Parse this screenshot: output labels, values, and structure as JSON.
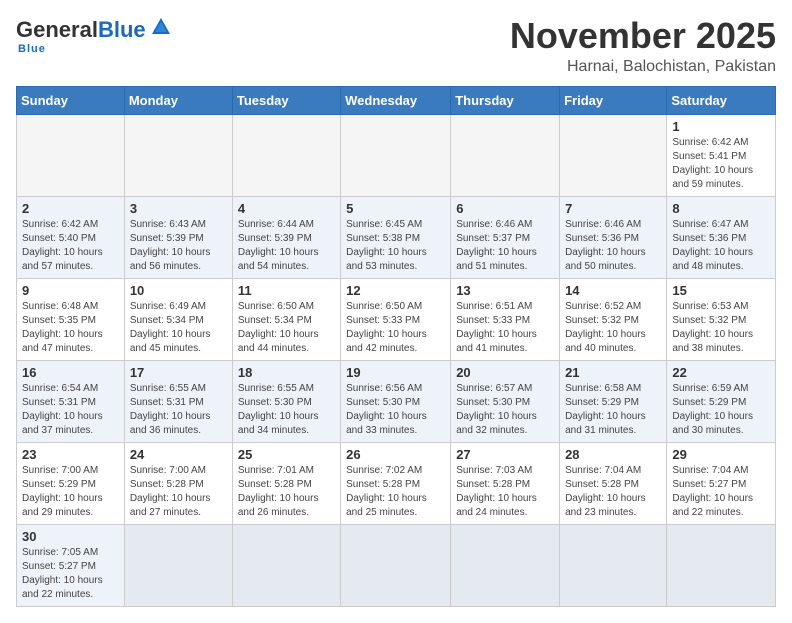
{
  "header": {
    "logo_general": "General",
    "logo_blue": "Blue",
    "tagline": "Blue",
    "title": "November 2025",
    "subtitle": "Harnai, Balochistan, Pakistan"
  },
  "days_of_week": [
    "Sunday",
    "Monday",
    "Tuesday",
    "Wednesday",
    "Thursday",
    "Friday",
    "Saturday"
  ],
  "weeks": [
    [
      {
        "day": "",
        "info": ""
      },
      {
        "day": "",
        "info": ""
      },
      {
        "day": "",
        "info": ""
      },
      {
        "day": "",
        "info": ""
      },
      {
        "day": "",
        "info": ""
      },
      {
        "day": "",
        "info": ""
      },
      {
        "day": "1",
        "info": "Sunrise: 6:42 AM\nSunset: 5:41 PM\nDaylight: 10 hours\nand 59 minutes."
      }
    ],
    [
      {
        "day": "2",
        "info": "Sunrise: 6:42 AM\nSunset: 5:40 PM\nDaylight: 10 hours\nand 57 minutes."
      },
      {
        "day": "3",
        "info": "Sunrise: 6:43 AM\nSunset: 5:39 PM\nDaylight: 10 hours\nand 56 minutes."
      },
      {
        "day": "4",
        "info": "Sunrise: 6:44 AM\nSunset: 5:39 PM\nDaylight: 10 hours\nand 54 minutes."
      },
      {
        "day": "5",
        "info": "Sunrise: 6:45 AM\nSunset: 5:38 PM\nDaylight: 10 hours\nand 53 minutes."
      },
      {
        "day": "6",
        "info": "Sunrise: 6:46 AM\nSunset: 5:37 PM\nDaylight: 10 hours\nand 51 minutes."
      },
      {
        "day": "7",
        "info": "Sunrise: 6:46 AM\nSunset: 5:36 PM\nDaylight: 10 hours\nand 50 minutes."
      },
      {
        "day": "8",
        "info": "Sunrise: 6:47 AM\nSunset: 5:36 PM\nDaylight: 10 hours\nand 48 minutes."
      }
    ],
    [
      {
        "day": "9",
        "info": "Sunrise: 6:48 AM\nSunset: 5:35 PM\nDaylight: 10 hours\nand 47 minutes."
      },
      {
        "day": "10",
        "info": "Sunrise: 6:49 AM\nSunset: 5:34 PM\nDaylight: 10 hours\nand 45 minutes."
      },
      {
        "day": "11",
        "info": "Sunrise: 6:50 AM\nSunset: 5:34 PM\nDaylight: 10 hours\nand 44 minutes."
      },
      {
        "day": "12",
        "info": "Sunrise: 6:50 AM\nSunset: 5:33 PM\nDaylight: 10 hours\nand 42 minutes."
      },
      {
        "day": "13",
        "info": "Sunrise: 6:51 AM\nSunset: 5:33 PM\nDaylight: 10 hours\nand 41 minutes."
      },
      {
        "day": "14",
        "info": "Sunrise: 6:52 AM\nSunset: 5:32 PM\nDaylight: 10 hours\nand 40 minutes."
      },
      {
        "day": "15",
        "info": "Sunrise: 6:53 AM\nSunset: 5:32 PM\nDaylight: 10 hours\nand 38 minutes."
      }
    ],
    [
      {
        "day": "16",
        "info": "Sunrise: 6:54 AM\nSunset: 5:31 PM\nDaylight: 10 hours\nand 37 minutes."
      },
      {
        "day": "17",
        "info": "Sunrise: 6:55 AM\nSunset: 5:31 PM\nDaylight: 10 hours\nand 36 minutes."
      },
      {
        "day": "18",
        "info": "Sunrise: 6:55 AM\nSunset: 5:30 PM\nDaylight: 10 hours\nand 34 minutes."
      },
      {
        "day": "19",
        "info": "Sunrise: 6:56 AM\nSunset: 5:30 PM\nDaylight: 10 hours\nand 33 minutes."
      },
      {
        "day": "20",
        "info": "Sunrise: 6:57 AM\nSunset: 5:30 PM\nDaylight: 10 hours\nand 32 minutes."
      },
      {
        "day": "21",
        "info": "Sunrise: 6:58 AM\nSunset: 5:29 PM\nDaylight: 10 hours\nand 31 minutes."
      },
      {
        "day": "22",
        "info": "Sunrise: 6:59 AM\nSunset: 5:29 PM\nDaylight: 10 hours\nand 30 minutes."
      }
    ],
    [
      {
        "day": "23",
        "info": "Sunrise: 7:00 AM\nSunset: 5:29 PM\nDaylight: 10 hours\nand 29 minutes."
      },
      {
        "day": "24",
        "info": "Sunrise: 7:00 AM\nSunset: 5:28 PM\nDaylight: 10 hours\nand 27 minutes."
      },
      {
        "day": "25",
        "info": "Sunrise: 7:01 AM\nSunset: 5:28 PM\nDaylight: 10 hours\nand 26 minutes."
      },
      {
        "day": "26",
        "info": "Sunrise: 7:02 AM\nSunset: 5:28 PM\nDaylight: 10 hours\nand 25 minutes."
      },
      {
        "day": "27",
        "info": "Sunrise: 7:03 AM\nSunset: 5:28 PM\nDaylight: 10 hours\nand 24 minutes."
      },
      {
        "day": "28",
        "info": "Sunrise: 7:04 AM\nSunset: 5:28 PM\nDaylight: 10 hours\nand 23 minutes."
      },
      {
        "day": "29",
        "info": "Sunrise: 7:04 AM\nSunset: 5:27 PM\nDaylight: 10 hours\nand 22 minutes."
      }
    ],
    [
      {
        "day": "30",
        "info": "Sunrise: 7:05 AM\nSunset: 5:27 PM\nDaylight: 10 hours\nand 22 minutes."
      },
      {
        "day": "",
        "info": ""
      },
      {
        "day": "",
        "info": ""
      },
      {
        "day": "",
        "info": ""
      },
      {
        "day": "",
        "info": ""
      },
      {
        "day": "",
        "info": ""
      },
      {
        "day": "",
        "info": ""
      }
    ]
  ]
}
